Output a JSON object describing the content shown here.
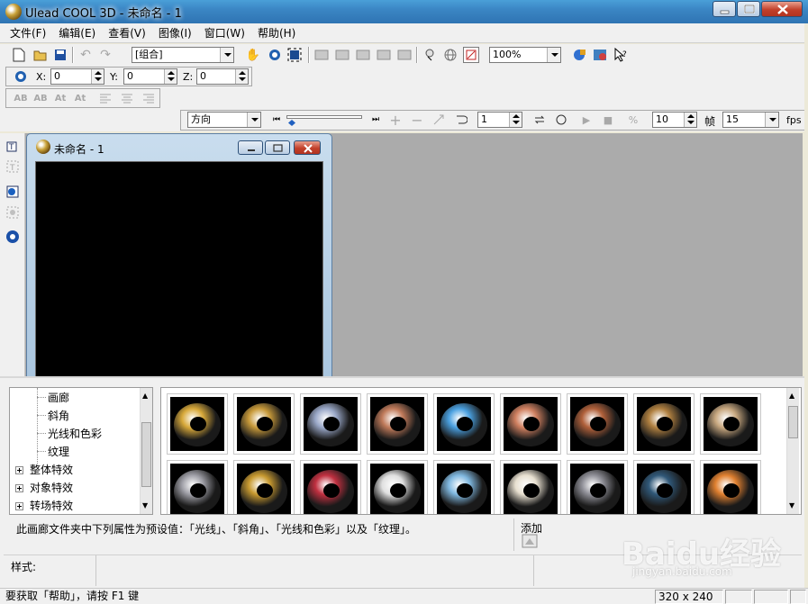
{
  "window": {
    "title": "Ulead COOL 3D - 未命名 - 1"
  },
  "menu": {
    "items": [
      "文件(F)",
      "编辑(E)",
      "查看(V)",
      "图像(I)",
      "窗口(W)",
      "帮助(H)"
    ]
  },
  "toolbar": {
    "object_combo": "[组合]",
    "zoom_combo": "100%",
    "x_label": "X:",
    "x_value": "0",
    "y_label": "Y:",
    "y_value": "0",
    "z_label": "Z:",
    "z_value": "0"
  },
  "animation": {
    "direction_combo": "方向",
    "frame_value": "1",
    "frames_total": "10",
    "frames_label": "帧",
    "fps_value": "15",
    "fps_label": "fps"
  },
  "document": {
    "title": "未命名 - 1"
  },
  "tree": {
    "children": [
      "画廊",
      "斜角",
      "光线和色彩",
      "纹理"
    ],
    "groups": [
      "整体特效",
      "对象特效",
      "转场特效"
    ]
  },
  "gallery": {
    "thumbnails": [
      {
        "name": "gold-ring-1",
        "color": "#d8a93a"
      },
      {
        "name": "gold-ring-2",
        "color": "#c89a3a"
      },
      {
        "name": "chrome-ring",
        "color": "#9aa8c8"
      },
      {
        "name": "copper-ring",
        "color": "#c07a5a"
      },
      {
        "name": "blue-stone-ring",
        "color": "#4aa0e0"
      },
      {
        "name": "terracotta-ring",
        "color": "#d08060"
      },
      {
        "name": "brick-ring",
        "color": "#b0603a"
      },
      {
        "name": "bronze-ring",
        "color": "#b08040"
      },
      {
        "name": "pattern-ring",
        "color": "#c8a880"
      },
      {
        "name": "steel-mesh-ring",
        "color": "#a0a0a8"
      },
      {
        "name": "gold-leopard-ring",
        "color": "#c89a30"
      },
      {
        "name": "stained-glass-ring",
        "color": "#c03040"
      },
      {
        "name": "white-ring",
        "color": "#e0e0e0"
      },
      {
        "name": "ice-ring",
        "color": "#80b8e0"
      },
      {
        "name": "pearl-ring",
        "color": "#e8e0d0"
      },
      {
        "name": "riveted-ring",
        "color": "#909098"
      },
      {
        "name": "dark-blue-ring",
        "color": "#305878"
      },
      {
        "name": "orange-ring",
        "color": "#e08030"
      }
    ]
  },
  "panel": {
    "description": "此画廊文件夹中下列属性为预设值：「光线」、「斜角」、「光线和色彩」以及「纹理」。",
    "add_label": "添加",
    "style_label": "样式:"
  },
  "status": {
    "help_text": "要获取「帮助」，请按 F1 键",
    "size": "320 x 240"
  },
  "watermark": {
    "text": "Baidu经验",
    "url": "jingyan.baidu.com"
  }
}
